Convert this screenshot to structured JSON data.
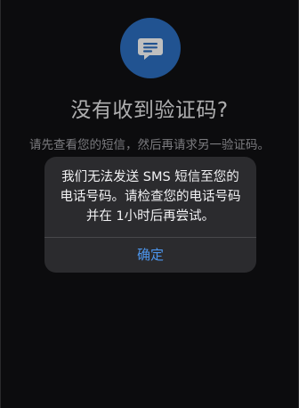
{
  "screen": {
    "icon": "message-bubble-icon",
    "title": "没有收到验证码?",
    "subtitle": "请先查看您的短信，然后再请求另一验证码。"
  },
  "alert": {
    "message": "我们无法发送 SMS 短信至您的电话号码。请检查您的电话号码并在 1小时后再尝试。",
    "ok_label": "确定"
  },
  "colors": {
    "accent": "#2d6fc2",
    "button_text": "#4c95ec",
    "background": "#111113",
    "alert_background": "#2b2b2e"
  }
}
